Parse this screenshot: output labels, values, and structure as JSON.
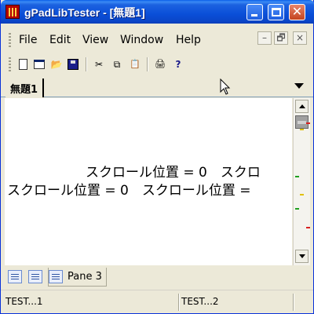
{
  "window": {
    "title": "gPadLibTester - [無題1]"
  },
  "menu": {
    "items": [
      "File",
      "Edit",
      "View",
      "Window",
      "Help"
    ]
  },
  "mdi_controls": {
    "minimize": "–",
    "restore": "🗗",
    "close": "×"
  },
  "toolbar": {
    "cut_glyph": "✂",
    "copy_glyph": "⧉",
    "paste_glyph": "📋",
    "print_glyph": "🖨",
    "help_glyph": "?",
    "open_glyph": "📂"
  },
  "tabs": {
    "active_label": "無題1"
  },
  "content": {
    "line1": "スクロール位置 = 0　スクロ",
    "line2": "スクロール位置 = 0　スクロール位置 = "
  },
  "scrollbar": {
    "marker_colors": [
      "#d82020",
      "#e0c000",
      "#20a020",
      "#e0c000",
      "#20a020",
      "#d82020"
    ]
  },
  "panes": {
    "active_label": "Pane 3"
  },
  "status": {
    "cell1": "TEST...1",
    "cell2": "TEST...2"
  }
}
